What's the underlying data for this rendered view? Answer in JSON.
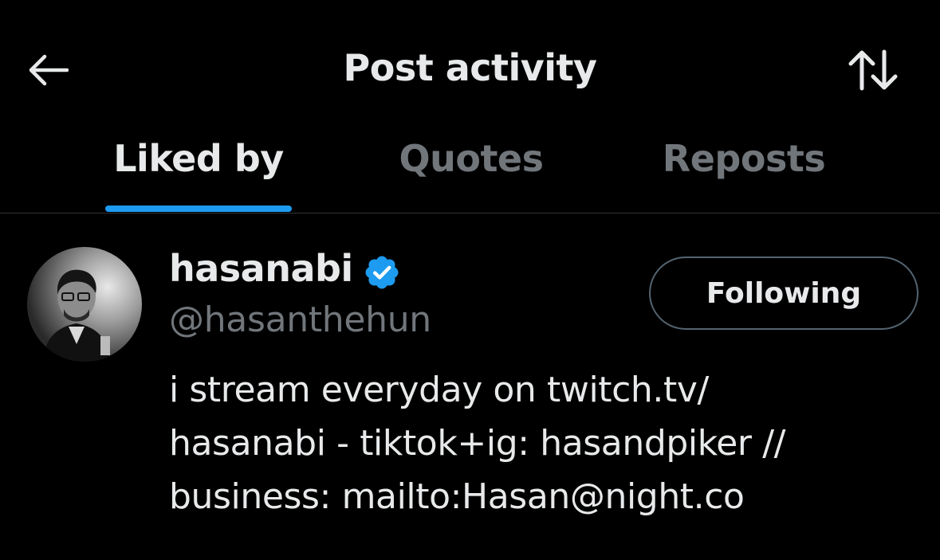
{
  "header": {
    "title": "Post activity",
    "back_icon": "arrow-left-icon",
    "sort_icon": "sort-arrows-icon"
  },
  "tabs": [
    {
      "label": "Liked by",
      "active": true
    },
    {
      "label": "Quotes",
      "active": false
    },
    {
      "label": "Reposts",
      "active": false
    }
  ],
  "user": {
    "display_name": "hasanabi",
    "verified": true,
    "handle": "@hasanthehun",
    "follow_label": "Following",
    "bio_lines": [
      "i stream everyday on twitch.tv/",
      "hasanabi - tiktok+ig: hasandpiker //",
      "business: mailto:Hasan@night.co"
    ]
  },
  "colors": {
    "background": "#000000",
    "text_primary": "#e7e9ea",
    "text_secondary": "#71767b",
    "accent": "#1d9bf0",
    "divider": "#2f3336"
  }
}
